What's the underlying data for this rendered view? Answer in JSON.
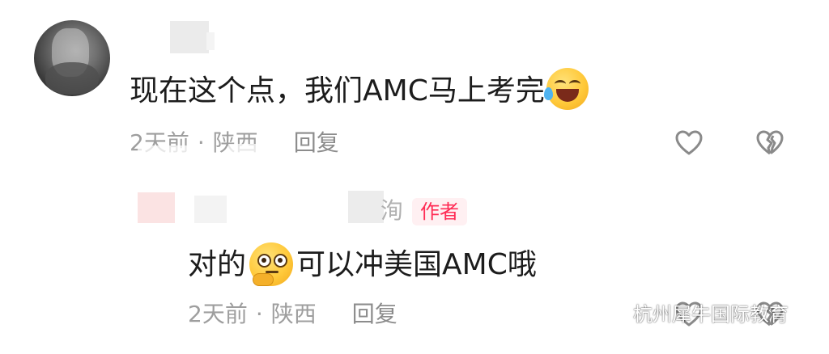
{
  "top_comment": {
    "text": "现在这个点，我们AMC马上考完",
    "emoji": "face-with-tears-of-joy",
    "meta": {
      "time": "2天前",
      "separator": "·",
      "location": "陕西",
      "reply_label": "回复"
    }
  },
  "reply_comment": {
    "name_fragment": "洵",
    "author_badge": "作者",
    "text_before_emoji": "对的",
    "emoji": "thinking-face",
    "text_after_emoji": "可以冲美国AMC哦",
    "meta": {
      "time": "2天前",
      "separator": "·",
      "location": "陕西",
      "reply_label": "回复"
    }
  },
  "watermark": {
    "text": "杭州犀牛国际教育"
  },
  "colors": {
    "text_primary": "#1c1c1c",
    "text_meta": "#9e9e9e",
    "author_badge_text": "#ff2c55",
    "author_badge_bg": "#fff0f2",
    "icon_stroke": "#8a8a8a"
  },
  "icons": {
    "like": "heart-outline-icon",
    "dislike": "broken-heart-outline-icon",
    "watermark": "wechat-icon"
  }
}
